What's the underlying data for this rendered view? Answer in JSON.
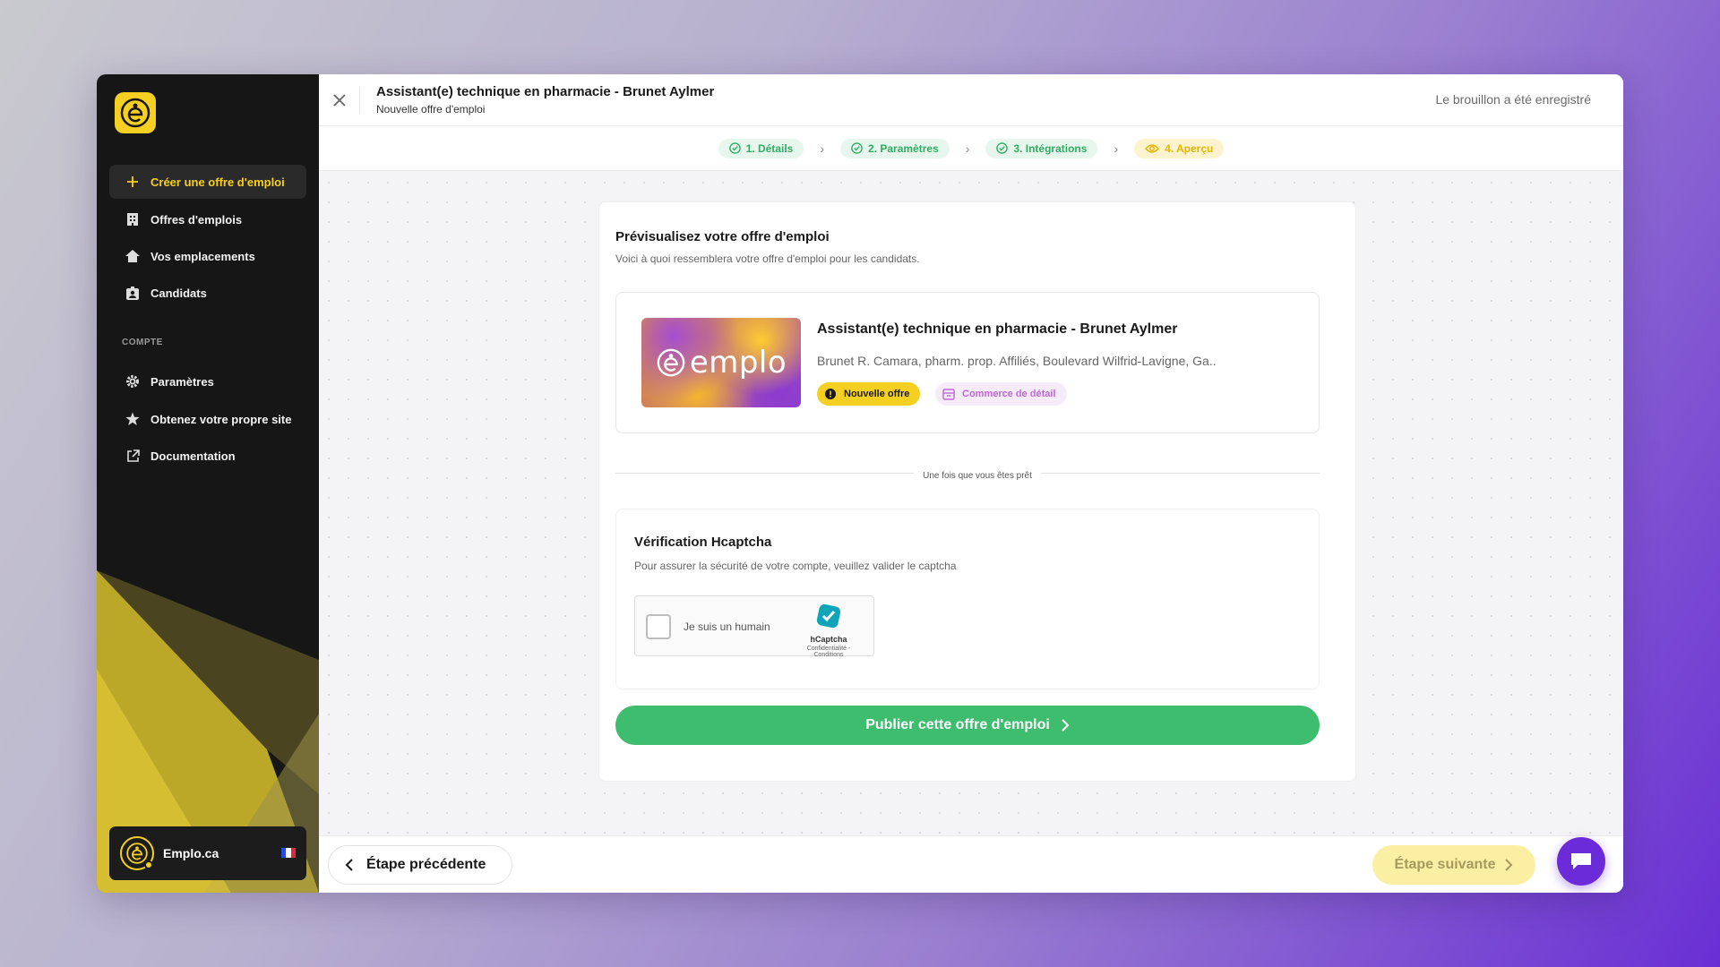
{
  "sidebar": {
    "create_label": "Créer une offre d'emploi",
    "items": [
      {
        "label": "Offres d'emplois",
        "icon": "building-icon"
      },
      {
        "label": "Vos emplacements",
        "icon": "home-icon"
      },
      {
        "label": "Candidats",
        "icon": "id-badge-icon"
      }
    ],
    "section_label": "COMPTE",
    "account_items": [
      {
        "label": "Paramètres",
        "icon": "gear-icon"
      },
      {
        "label": "Obtenez votre propre site",
        "icon": "star-icon"
      },
      {
        "label": "Documentation",
        "icon": "external-link-icon"
      }
    ],
    "account_name": "Emplo.ca"
  },
  "header": {
    "title": "Assistant(e) technique en pharmacie - Brunet Aylmer",
    "subtitle": "Nouvelle offre d'emploi",
    "draft_status": "Le brouillon a été enregistré"
  },
  "steps": [
    {
      "label": "1. Détails",
      "state": "done"
    },
    {
      "label": "2. Paramètres",
      "state": "done"
    },
    {
      "label": "3. Intégrations",
      "state": "done"
    },
    {
      "label": "4. Aperçu",
      "state": "current"
    }
  ],
  "preview": {
    "heading": "Prévisualisez votre offre d'emploi",
    "description": "Voici à quoi ressemblera votre offre d'emploi pour les candidats.",
    "logo_word": "emplo",
    "job_title": "Assistant(e) technique en pharmacie - Brunet Aylmer",
    "location": "Brunet R. Camara, pharm. prop. Affiliés, Boulevard Wilfrid-Lavigne, Ga..",
    "badge_new": "Nouvelle offre",
    "badge_category": "Commerce de détail"
  },
  "divider_label": "Une fois que vous êtes prêt",
  "captcha": {
    "heading": "Vérification Hcaptcha",
    "description": "Pour assurer la sécurité de votre compte, veuillez valider le captcha",
    "checkbox_label": "Je suis un humain",
    "brand": "hCaptcha",
    "links": "Confidentialité - Conditions"
  },
  "publish_label": "Publier cette offre d'emploi",
  "footer": {
    "prev_label": "Étape précédente",
    "next_label": "Étape suivante"
  },
  "colors": {
    "brand_yellow": "#f5d020",
    "success_green": "#3dbd6d",
    "chat_purple": "#6c2bd9",
    "sidebar_bg": "#161616"
  }
}
